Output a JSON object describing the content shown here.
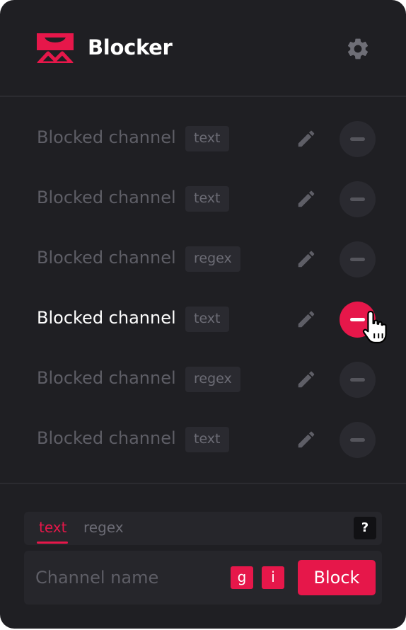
{
  "app": {
    "title": "Blocker",
    "accent_color": "#e6174a",
    "logo_icon": "blocker-logo-icon",
    "settings_icon": "gear-icon"
  },
  "list": {
    "items": [
      {
        "name": "Blocked channel",
        "type": "text",
        "state": "normal"
      },
      {
        "name": "Blocked channel",
        "type": "text",
        "state": "normal"
      },
      {
        "name": "Blocked channel",
        "type": "regex",
        "state": "normal"
      },
      {
        "name": "Blocked channel",
        "type": "text",
        "state": "hovered"
      },
      {
        "name": "Blocked channel",
        "type": "regex",
        "state": "normal"
      },
      {
        "name": "Blocked channel",
        "type": "text",
        "state": "normal"
      }
    ],
    "edit_icon": "pencil-icon",
    "remove_icon": "minus-icon"
  },
  "form": {
    "tabs": [
      {
        "label": "text",
        "selected": true
      },
      {
        "label": "regex",
        "selected": false
      }
    ],
    "help_label": "?",
    "input_placeholder": "Channel name",
    "input_value": "",
    "flags": [
      {
        "label": "g"
      },
      {
        "label": "i"
      }
    ],
    "submit_label": "Block"
  }
}
